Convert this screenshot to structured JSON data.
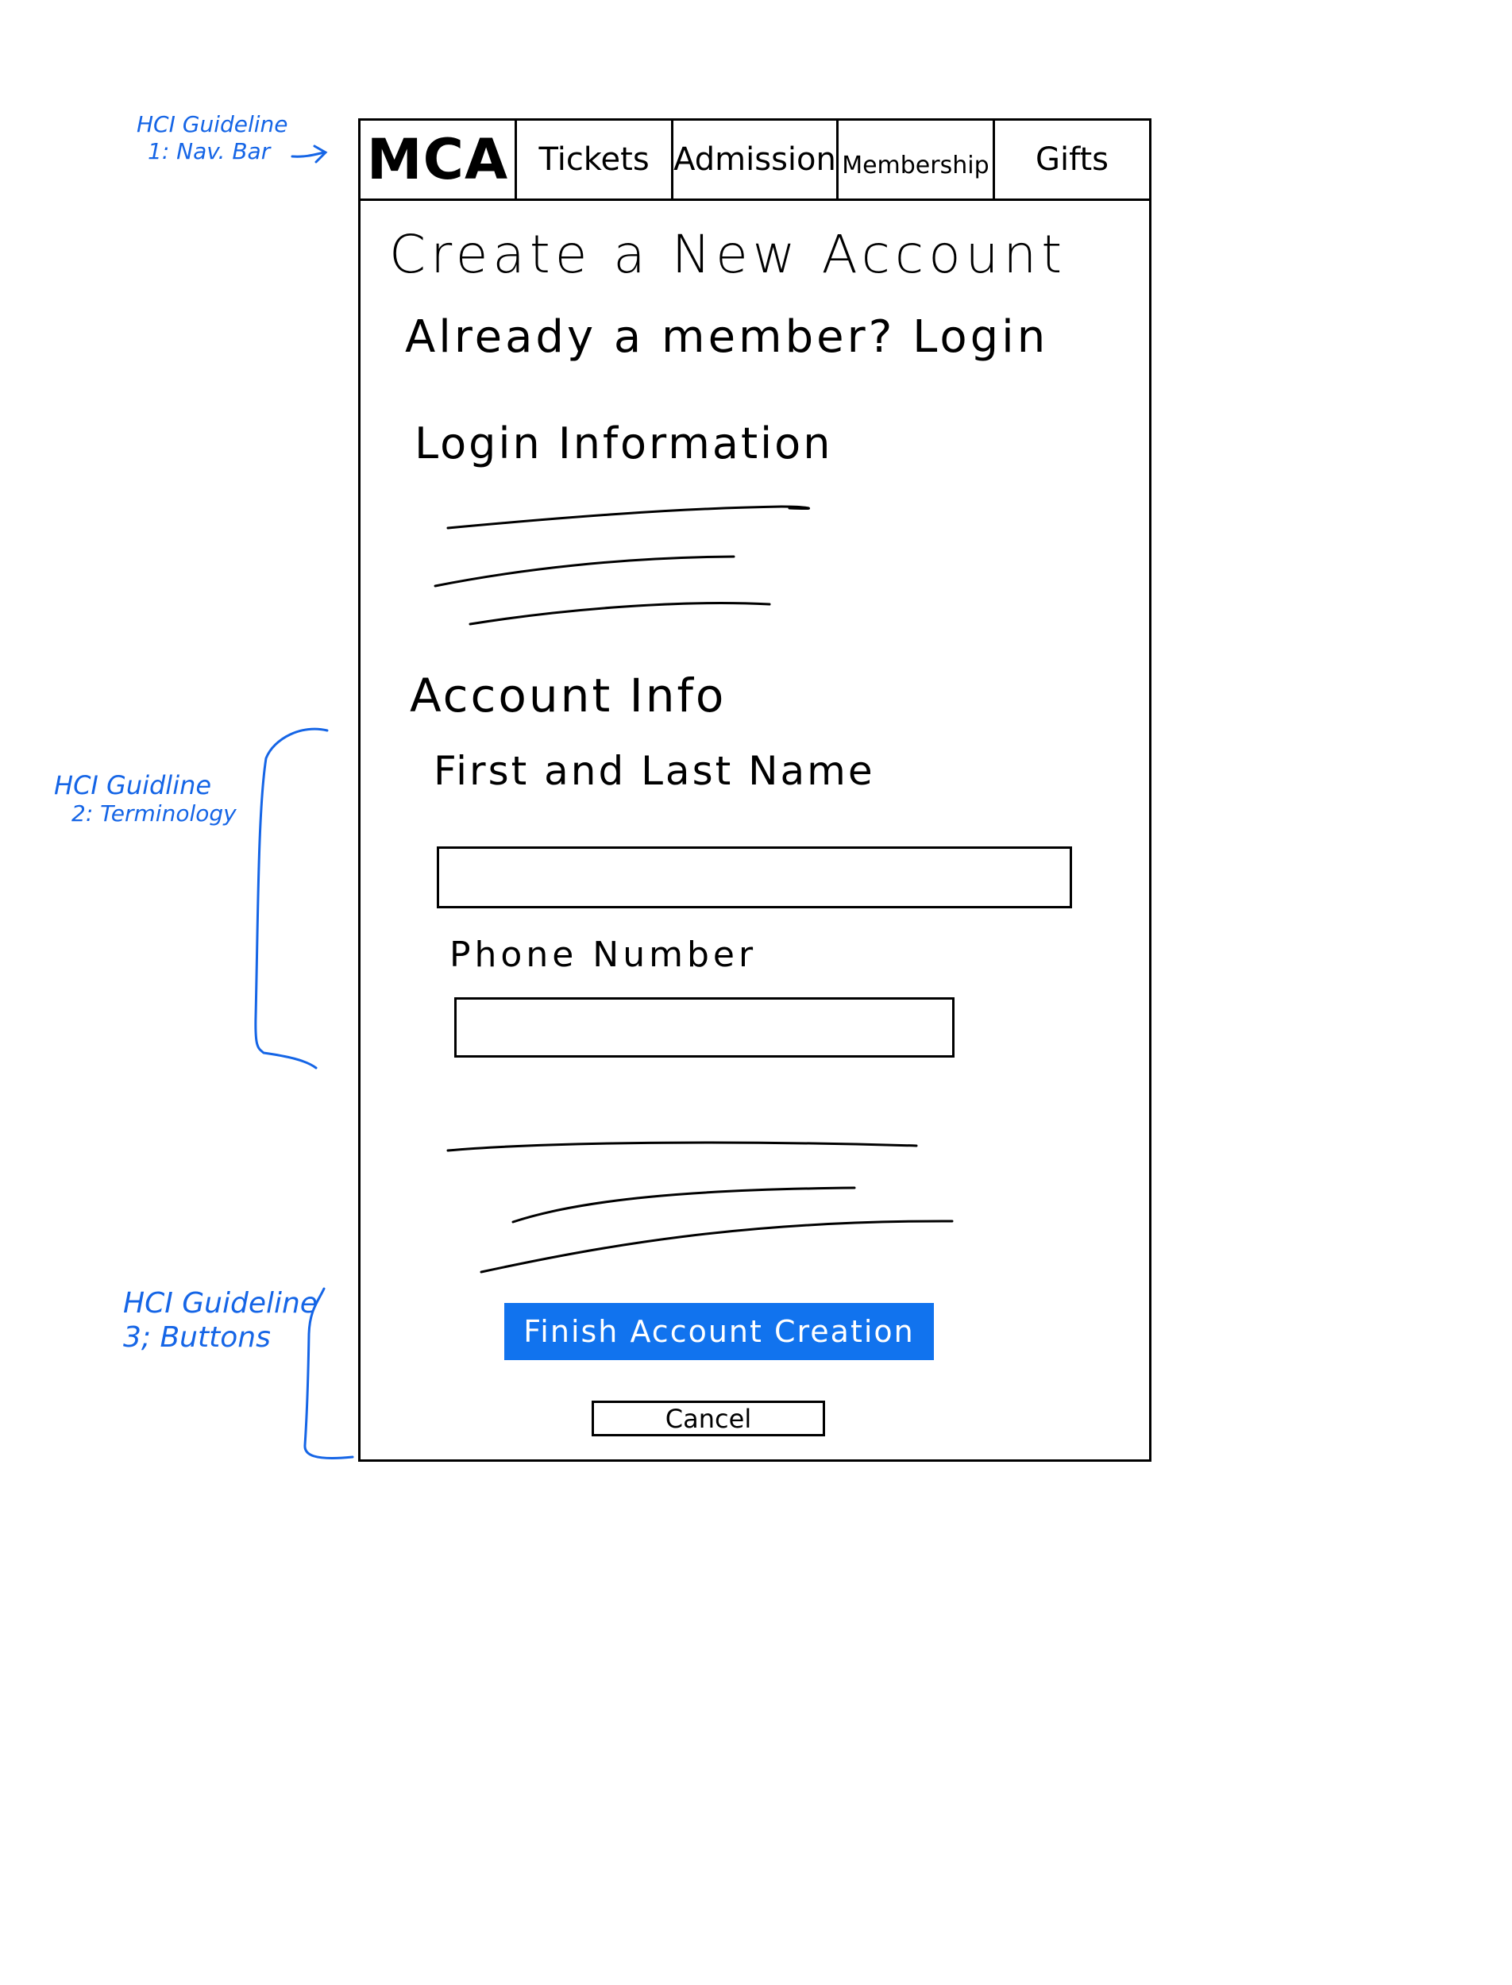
{
  "annotations": {
    "nav_bar": {
      "line1": "HCI Guideline",
      "line2": "1: Nav. Bar"
    },
    "terminology": {
      "line1": "HCI Guidline",
      "line2": "2: Terminology"
    },
    "buttons": {
      "line1": "HCI Guideline",
      "line2": "3; Buttons"
    }
  },
  "nav": {
    "logo": "MCA",
    "items": [
      {
        "label": "Tickets"
      },
      {
        "label": "Admission"
      },
      {
        "label": "Membership"
      },
      {
        "label": "Gifts"
      }
    ]
  },
  "form": {
    "title": "Create a New Account",
    "login_prompt": "Already a member?",
    "login_link": "Login",
    "login_section_heading": "Login Information",
    "account_section_heading": "Account Info",
    "name_label": "First and Last Name",
    "phone_label": "Phone Number",
    "finish_button": "Finish Account Creation",
    "cancel_button": "Cancel"
  },
  "colors": {
    "annotation_ink": "#1565e6",
    "primary_button": "#1173ee"
  }
}
